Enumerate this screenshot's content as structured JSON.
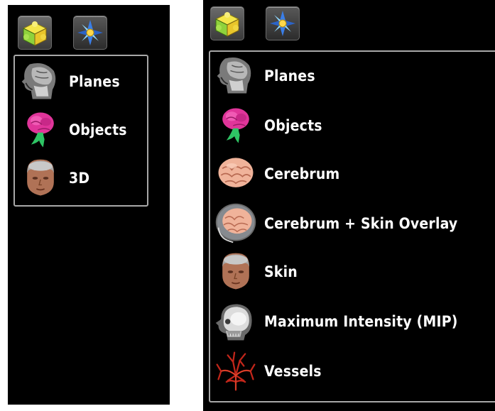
{
  "left_panel": {
    "toolbar": [
      {
        "icon": "puzzle-cube-icon",
        "selected": true
      },
      {
        "icon": "compass-star-icon",
        "selected": false
      }
    ],
    "items": [
      {
        "label": "Planes",
        "icon": "sagittal-mri-head-icon"
      },
      {
        "label": "Objects",
        "icon": "pink-brain-object-icon"
      },
      {
        "label": "3D",
        "icon": "skin-head-3d-icon"
      }
    ]
  },
  "right_panel": {
    "toolbar": [
      {
        "icon": "puzzle-cube-icon",
        "selected": true
      },
      {
        "icon": "compass-star-icon",
        "selected": false
      }
    ],
    "items": [
      {
        "label": "Planes",
        "icon": "sagittal-mri-head-icon"
      },
      {
        "label": "Objects",
        "icon": "pink-brain-object-icon"
      },
      {
        "label": "Cerebrum",
        "icon": "cerebrum-icon"
      },
      {
        "label": "Cerebrum + Skin Overlay",
        "icon": "cerebrum-skin-overlay-icon"
      },
      {
        "label": "Skin",
        "icon": "skin-head-icon"
      },
      {
        "label": "Maximum Intensity (MIP)",
        "icon": "mip-skull-icon"
      },
      {
        "label": "Vessels",
        "icon": "vessels-icon"
      }
    ]
  },
  "colors": {
    "background": "#000000",
    "border": "#a8a8a8",
    "text": "#ffffff",
    "brain_pink": "#e0359a",
    "cerebrum": "#f0b39a",
    "vessel_red": "#c2261a"
  }
}
